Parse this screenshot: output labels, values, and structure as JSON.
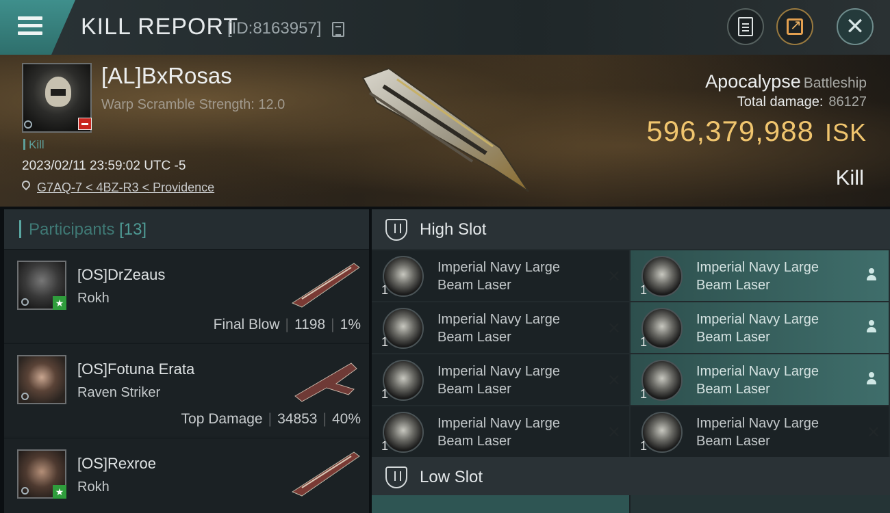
{
  "header": {
    "title": "KILL REPORT",
    "report_id": "[ID:8163957]"
  },
  "victim": {
    "name": "[AL]BxRosas",
    "warp_scramble": "Warp Scramble Strength: 12.0",
    "kill_tag": "Kill",
    "datetime": "2023/02/11 23:59:02 UTC -5",
    "location": "G7AQ-7 < 4BZ-R3 < Providence",
    "ship": "Apocalypse",
    "ship_class": "Battleship",
    "total_damage_label": "Total damage:",
    "total_damage": "86127",
    "isk_value": "596,379,988",
    "isk_unit": "ISK",
    "result": "Kill"
  },
  "participants": {
    "label": "Participants",
    "count": "[13]",
    "list": [
      {
        "name": "[OS]DrZeaus",
        "ship": "Rokh",
        "stat_label": "Final Blow",
        "damage": "1198",
        "percent": "1%"
      },
      {
        "name": "[OS]Fotuna Erata",
        "ship": "Raven Striker",
        "stat_label": "Top Damage",
        "damage": "34853",
        "percent": "40%"
      },
      {
        "name": "[OS]Rexroe",
        "ship": "Rokh",
        "stat_label": "",
        "damage": "",
        "percent": ""
      }
    ]
  },
  "slots": {
    "high": {
      "label": "High Slot",
      "items": [
        {
          "name": "Imperial Navy Large Beam Laser",
          "qty": "1",
          "status": "destroyed"
        },
        {
          "name": "Imperial Navy Large Beam Laser",
          "qty": "1",
          "status": "dropped"
        },
        {
          "name": "Imperial Navy Large Beam Laser",
          "qty": "1",
          "status": "destroyed"
        },
        {
          "name": "Imperial Navy Large Beam Laser",
          "qty": "1",
          "status": "dropped"
        },
        {
          "name": "Imperial Navy Large Beam Laser",
          "qty": "1",
          "status": "destroyed"
        },
        {
          "name": "Imperial Navy Large Beam Laser",
          "qty": "1",
          "status": "dropped"
        },
        {
          "name": "Imperial Navy Large Beam Laser",
          "qty": "1",
          "status": "destroyed"
        },
        {
          "name": "Imperial Navy Large Beam Laser",
          "qty": "1",
          "status": "destroyed"
        }
      ]
    },
    "low": {
      "label": "Low Slot"
    }
  },
  "colors": {
    "accent": "#3f8f8c",
    "isk_gold": "#f0c56e",
    "dropped_row": "#3f6e6b"
  }
}
